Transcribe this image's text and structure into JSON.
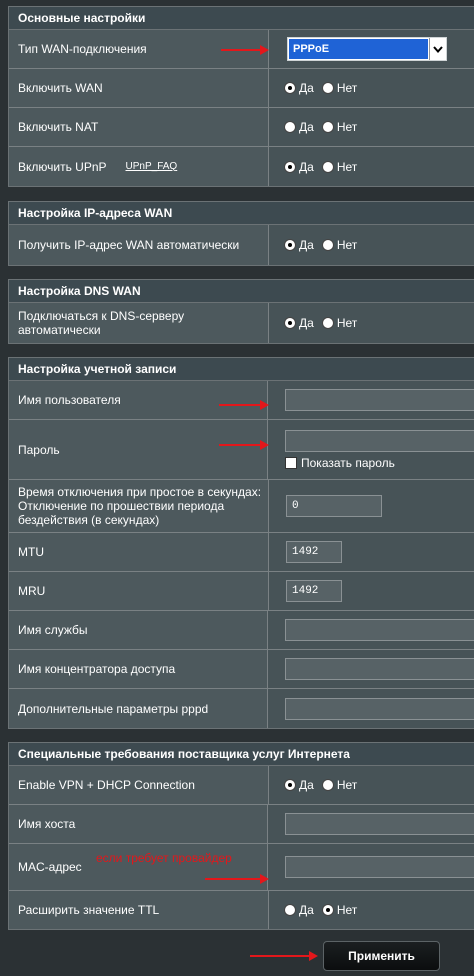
{
  "basic": {
    "title": "Основные настройки",
    "wan_type_label": "Тип WAN-подключения",
    "wan_type_value": "PPPoE",
    "enable_wan_label": "Включить WAN",
    "enable_nat_label": "Включить NAT",
    "enable_upnp_label": "Включить UPnP",
    "upnp_faq": "UPnP_FAQ"
  },
  "radio": {
    "yes": "Да",
    "no": "Нет"
  },
  "ip": {
    "title": "Настройка IP-адреса WAN",
    "auto_label": "Получить IP-адрес WAN автоматически"
  },
  "dns": {
    "title": "Настройка DNS WAN",
    "auto_label": "Подключаться к DNS-серверу автоматически"
  },
  "account": {
    "title": "Настройка учетной записи",
    "username_label": "Имя пользователя",
    "password_label": "Пароль",
    "show_password": "Показать пароль",
    "idle_label": "Время отключения при простое в секундах: Отключение по прошествии периода бездействия (в секундах)",
    "idle_value": "0",
    "mtu_label": "MTU",
    "mtu_value": "1492",
    "mru_label": "MRU",
    "mru_value": "1492",
    "service_label": "Имя службы",
    "concentrator_label": "Имя концентратора доступа",
    "pppd_label": "Дополнительные параметры pppd"
  },
  "isp": {
    "title": "Специальные требования поставщика услуг Интернета",
    "vpn_dhcp_label": "Enable VPN + DHCP Connection",
    "hostname_label": "Имя хоста",
    "mac_label": "MAC-адрес",
    "mac_note": "если требует провайдер",
    "ttl_label": "Расширить значение TTL"
  },
  "apply_button": "Применить",
  "colors": {
    "panel": "#4d595d",
    "header": "#3d4a50",
    "select": "#1f63d6",
    "arrow": "#e3171b"
  }
}
